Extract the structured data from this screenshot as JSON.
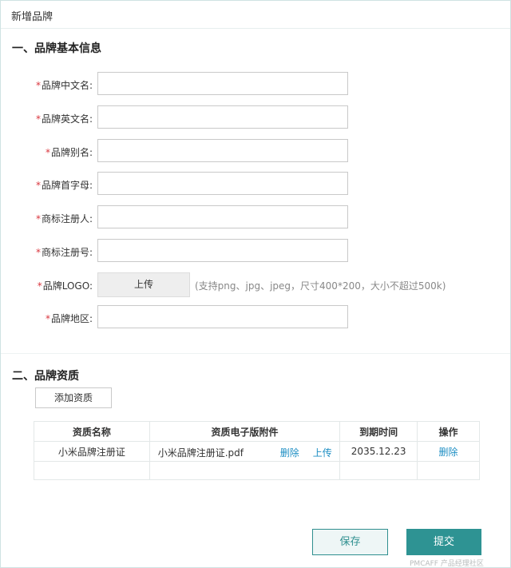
{
  "window": {
    "title": "新增品牌"
  },
  "section1": {
    "title": "一、品牌基本信息"
  },
  "form": {
    "required_mark": "*",
    "fields": [
      {
        "label": "品牌中文名:",
        "value": ""
      },
      {
        "label": "品牌英文名:",
        "value": ""
      },
      {
        "label": "品牌别名:",
        "value": ""
      },
      {
        "label": "品牌首字母:",
        "value": ""
      },
      {
        "label": "商标注册人:",
        "value": ""
      },
      {
        "label": "商标注册号:",
        "value": ""
      }
    ],
    "logo": {
      "label": "品牌LOGO:",
      "upload_label": "上传",
      "hint": "(支持png、jpg、jpeg，尺寸400*200，大小不超过500k)"
    },
    "region": {
      "label": "品牌地区:",
      "value": ""
    }
  },
  "section2": {
    "title": "二、品牌资质",
    "add_button": "添加资质"
  },
  "qual_table": {
    "headers": [
      "资质名称",
      "资质电子版附件",
      "到期时间",
      "操作"
    ],
    "rows": [
      {
        "name": "小米品牌注册证",
        "file": "小米品牌注册证.pdf",
        "file_delete": "删除",
        "file_upload": "上传",
        "expiry": "2035.12.23",
        "action": "删除"
      }
    ]
  },
  "actions": {
    "save": "保存",
    "submit": "提交"
  },
  "footer_mark": "PMCAFF 产品经理社区",
  "colors": {
    "accent": "#2e9393",
    "required": "#d9363e",
    "link": "#1f8fc4"
  }
}
